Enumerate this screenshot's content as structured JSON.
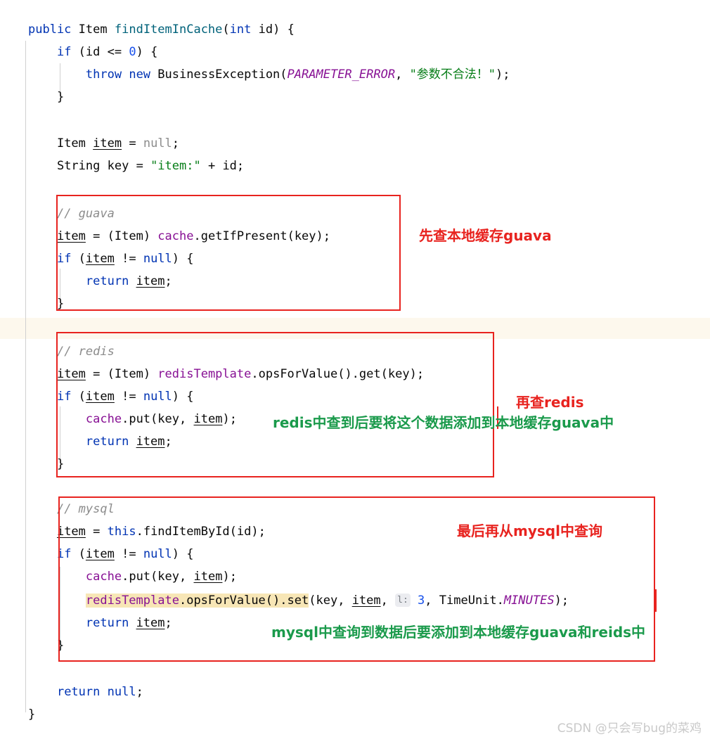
{
  "editor": {
    "language": "java",
    "font_size_px": 17,
    "line_height_px": 32,
    "colors": {
      "background": "#ffffff",
      "keyword": "#0033b3",
      "field": "#871094",
      "string": "#067d17",
      "comment": "#8c8c8c",
      "number": "#1750eb",
      "method_declaration": "#00627a",
      "caret_row": "#fdf8ed",
      "identifier_highlight": "#f7e6b6",
      "annotation_red": "#e8231f",
      "annotation_green": "#1a9a4b",
      "box_border": "#e8231f"
    },
    "code_lines": [
      {
        "id": "l1",
        "text": "public Item findItemInCache(int id) {"
      },
      {
        "id": "l2",
        "text": "    if (id <= 0) {"
      },
      {
        "id": "l3",
        "text": "        throw new BusinessException(PARAMETER_ERROR, \"参数不合法！\");"
      },
      {
        "id": "l4",
        "text": "    }"
      },
      {
        "id": "l5",
        "text": ""
      },
      {
        "id": "l6",
        "text": "    Item item = null;"
      },
      {
        "id": "l7",
        "text": "    String key = \"item:\" + id;"
      },
      {
        "id": "l8",
        "text": ""
      },
      {
        "id": "l9",
        "text": "    // guava"
      },
      {
        "id": "l10",
        "text": "    item = (Item) cache.getIfPresent(key);"
      },
      {
        "id": "l11",
        "text": "    if (item != null) {"
      },
      {
        "id": "l12",
        "text": "        return item;"
      },
      {
        "id": "l13",
        "text": "    }"
      },
      {
        "id": "l14",
        "text": ""
      },
      {
        "id": "l15",
        "text": "    // redis"
      },
      {
        "id": "l16",
        "text": "    item = (Item) redisTemplate.opsForValue().get(key);"
      },
      {
        "id": "l17",
        "text": "    if (item != null) {"
      },
      {
        "id": "l18",
        "text": "        cache.put(key, item);"
      },
      {
        "id": "l19",
        "text": "        return item;"
      },
      {
        "id": "l20",
        "text": "    }"
      },
      {
        "id": "l21",
        "text": ""
      },
      {
        "id": "l22",
        "text": "    // mysql"
      },
      {
        "id": "l23",
        "text": "    item = this.findItemById(id);"
      },
      {
        "id": "l24",
        "text": "    if (item != null) {"
      },
      {
        "id": "l25",
        "text": "        cache.put(key, item);"
      },
      {
        "id": "l26",
        "text": "        redisTemplate.opsForValue().set(key, item, l: 3, TimeUnit.MINUTES);"
      },
      {
        "id": "l27",
        "text": "        return item;"
      },
      {
        "id": "l28",
        "text": "    }"
      },
      {
        "id": "l29",
        "text": ""
      },
      {
        "id": "l30",
        "text": "    return null;"
      },
      {
        "id": "l31",
        "text": "}"
      }
    ],
    "tokens": {
      "kw_public": "public",
      "kw_if": "if",
      "kw_throw": "throw",
      "kw_new": "new",
      "kw_return": "return",
      "kw_null": "null",
      "kw_int": "int",
      "kw_this": "this",
      "type_item": "Item",
      "type_string": "String",
      "type_exception": "BusinessException",
      "type_timeunit": "TimeUnit",
      "method_decl": "findItemInCache",
      "m_getIfPresent": "getIfPresent",
      "m_opsForValue": "opsForValue",
      "m_get": "get",
      "m_set": "set",
      "m_put": "put",
      "m_findItemById": "findItemById",
      "f_cache": "cache",
      "f_redisTemplate": "redisTemplate",
      "const_param_error": "PARAMETER_ERROR",
      "const_minutes": "MINUTES",
      "var_item": "item",
      "var_key": "key",
      "var_id": "id",
      "str_error_msg": "\"参数不合法！\"",
      "str_item_prefix": "\"item:\"",
      "num_zero": "0",
      "num_three": "3",
      "comment_guava": "// guava",
      "comment_redis": "// redis",
      "comment_mysql": "// mysql",
      "inlay_hint_l": "l:"
    }
  },
  "annotations": {
    "guava_label": "先查本地缓存guava",
    "redis_label": "再查redis",
    "redis_note": "redis中查到后要将这个数据添加到本地缓存guava中",
    "mysql_label": "最后再从mysql中查询",
    "mysql_note": "mysql中查询到数据后要添加到本地缓存guava和reids中"
  },
  "boxes": [
    {
      "id": "box-guava",
      "label": "guava block highlight box"
    },
    {
      "id": "box-redis",
      "label": "redis block highlight box"
    },
    {
      "id": "box-mysql",
      "label": "mysql block highlight box"
    }
  ],
  "watermark": {
    "text": "CSDN @只会写bug的菜鸡"
  }
}
